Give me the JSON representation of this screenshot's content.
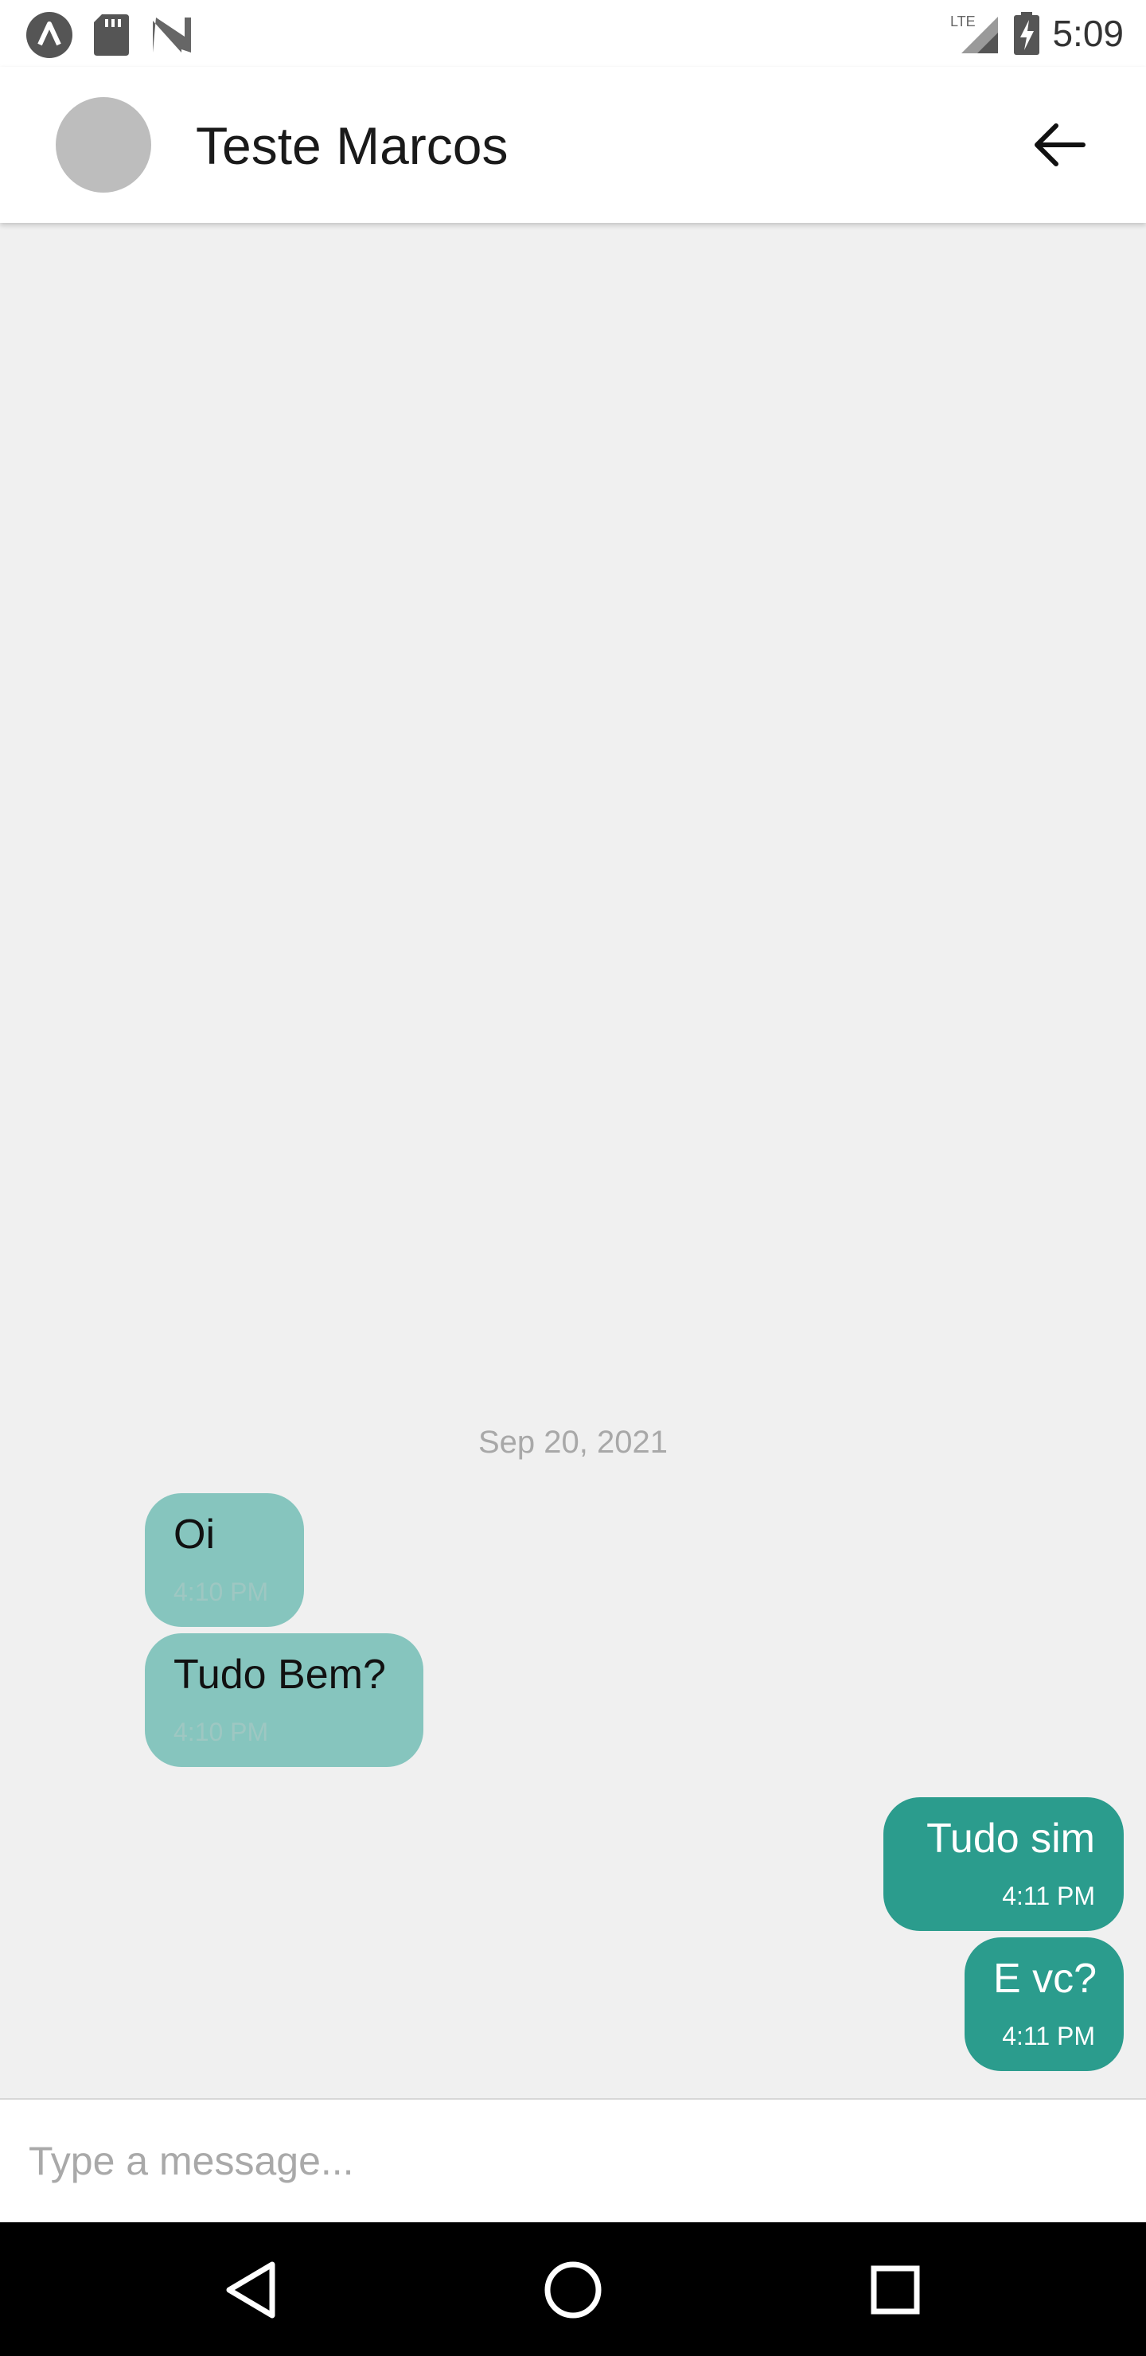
{
  "status_bar": {
    "time": "5:09",
    "network_label": "LTE",
    "icons_left": [
      "app-notification-icon",
      "sd-card-icon",
      "n-logo-icon"
    ],
    "icons_right": [
      "lte-signal-icon",
      "battery-charging-icon"
    ]
  },
  "header": {
    "contact_name": "Teste Marcos",
    "avatar_color": "#bdbdbd",
    "back_icon": "arrow-left-icon"
  },
  "chat": {
    "date_separator": "Sep 20, 2021",
    "messages": [
      {
        "direction": "received",
        "text": "Oi",
        "time": "4:10 PM"
      },
      {
        "direction": "received",
        "text": "Tudo Bem?",
        "time": "4:10 PM"
      },
      {
        "direction": "sent",
        "text": "Tudo sim",
        "time": "4:11 PM"
      },
      {
        "direction": "sent",
        "text": "E vc?",
        "time": "4:11 PM"
      }
    ],
    "colors": {
      "received_bubble": "#86c5be",
      "sent_bubble": "#2b9c8d",
      "background": "#f0f0f0"
    }
  },
  "composer": {
    "placeholder": "Type a message...",
    "value": ""
  },
  "nav_bar": {
    "buttons": [
      "back-triangle-icon",
      "home-circle-icon",
      "recents-square-icon"
    ]
  }
}
